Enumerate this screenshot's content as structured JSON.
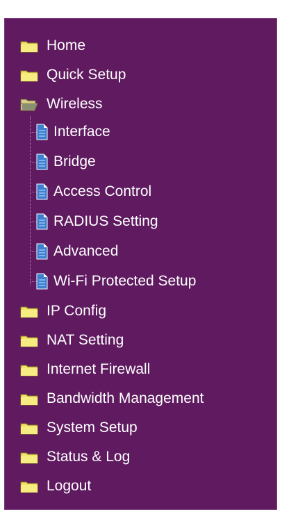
{
  "menu": {
    "items": [
      {
        "label": "Home",
        "icon": "folder-closed-icon"
      },
      {
        "label": "Quick Setup",
        "icon": "folder-closed-icon"
      },
      {
        "label": "Wireless",
        "icon": "folder-open-icon"
      },
      {
        "label": "IP Config",
        "icon": "folder-closed-icon"
      },
      {
        "label": "NAT Setting",
        "icon": "folder-closed-icon"
      },
      {
        "label": "Internet Firewall",
        "icon": "folder-closed-icon"
      },
      {
        "label": "Bandwidth Management",
        "icon": "folder-closed-icon"
      },
      {
        "label": "System Setup",
        "icon": "folder-closed-icon"
      },
      {
        "label": "Status & Log",
        "icon": "folder-closed-icon"
      },
      {
        "label": "Logout",
        "icon": "folder-closed-icon"
      }
    ],
    "wireless_sub": [
      {
        "label": "Interface",
        "icon": "page-icon"
      },
      {
        "label": "Bridge",
        "icon": "page-icon"
      },
      {
        "label": "Access Control",
        "icon": "page-icon"
      },
      {
        "label": "RADIUS Setting",
        "icon": "page-icon"
      },
      {
        "label": "Advanced",
        "icon": "page-icon"
      },
      {
        "label": "Wi-Fi Protected Setup",
        "icon": "page-icon"
      }
    ]
  },
  "colors": {
    "background": "#5f1a60",
    "text": "#ffffff",
    "folder": "#f2e46a",
    "page_blue": "#3a7fd0"
  }
}
